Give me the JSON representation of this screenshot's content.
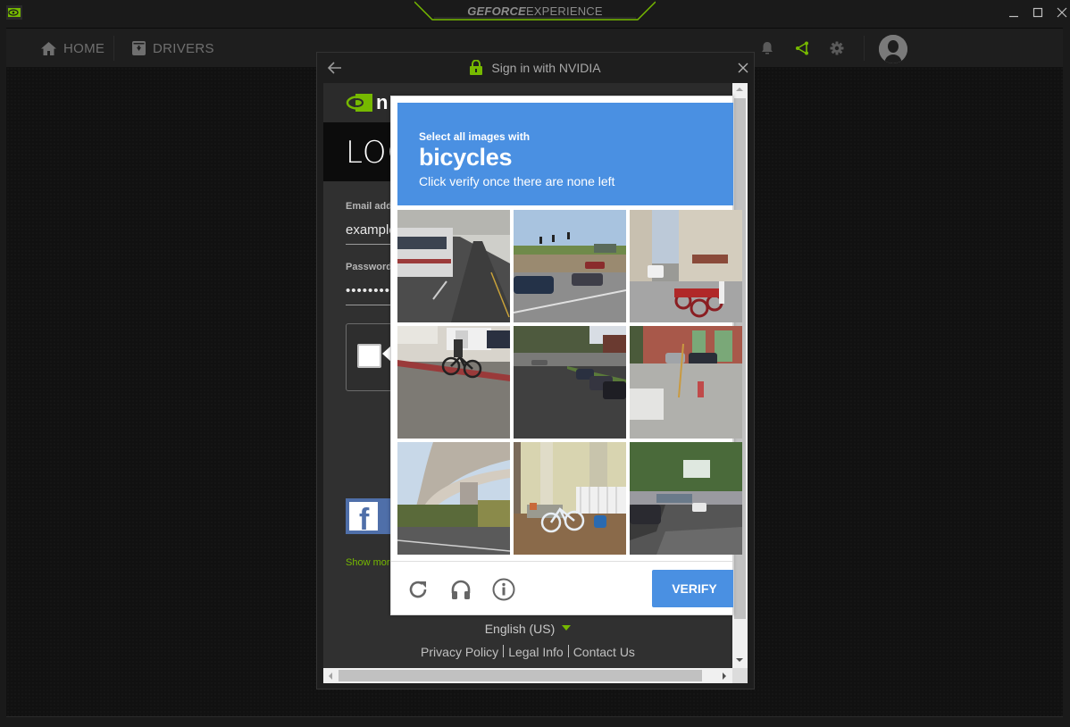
{
  "app": {
    "brand_bold": "GEFORCE",
    "brand_light": "EXPERIENCE",
    "brand_tm": "™",
    "accent_color": "#76b900"
  },
  "nav": {
    "items": [
      {
        "label": "HOME",
        "icon": "home-icon"
      },
      {
        "label": "DRIVERS",
        "icon": "drivers-icon"
      }
    ],
    "right_icons": [
      "bell-icon",
      "share-icon",
      "gear-icon",
      "avatar"
    ]
  },
  "window_controls": [
    "minimize",
    "maximize",
    "close"
  ],
  "dialog": {
    "title": "Sign in with NVIDIA",
    "back_icon": "back-arrow-icon",
    "close_icon": "close-icon",
    "page": {
      "logo_text": "n",
      "heading": "LOG",
      "email_label": "Email addr",
      "email_value": "example",
      "password_label": "Password",
      "password_value": "••••••••",
      "show_more": "Show more",
      "language": "English (US)",
      "footer_links": [
        "Privacy Policy",
        "Legal Info",
        "Contact Us"
      ]
    }
  },
  "captcha": {
    "instruction_top": "Select all images with",
    "target": "bicycles",
    "instruction_bottom": "Click verify once there are none left",
    "verify_label": "VERIFY",
    "tiles": [
      {
        "desc": "bus in covered terminal"
      },
      {
        "desc": "intersection with traffic lights and cars"
      },
      {
        "desc": "street with parked motorcycles"
      },
      {
        "desc": "cyclist on road"
      },
      {
        "desc": "residential street with parked cars"
      },
      {
        "desc": "brick building with fire hydrant"
      },
      {
        "desc": "highway overpass"
      },
      {
        "desc": "house porch with bicycle"
      },
      {
        "desc": "tree-lined street"
      }
    ],
    "banner_color": "#4a90e2",
    "footer_icons": [
      "reload-icon",
      "audio-icon",
      "info-icon"
    ]
  }
}
